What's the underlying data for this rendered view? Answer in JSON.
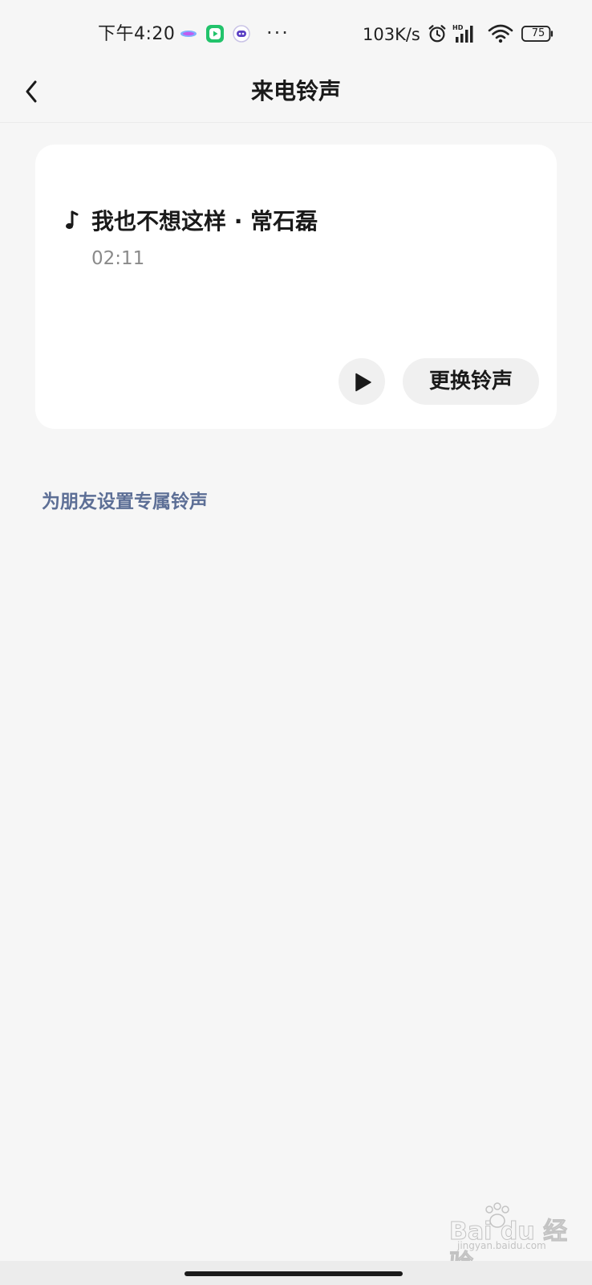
{
  "status_bar": {
    "time": "下午4:20",
    "more_indicator": "···",
    "network_speed": "103K/s",
    "battery_level": "75",
    "icons": [
      "bubble-app-icon",
      "green-play-app-icon",
      "astronaut-app-icon",
      "alarm-icon",
      "hd-signal-icon",
      "wifi-icon",
      "battery-icon"
    ]
  },
  "header": {
    "title": "来电铃声",
    "back_icon": "chevron-left-icon"
  },
  "ringtone_card": {
    "note_icon": "music-note-icon",
    "song_title": "我也不想这样 · 常石磊",
    "duration": "02:11",
    "play_icon": "play-icon",
    "change_button_label": "更换铃声"
  },
  "friend_ringtone": {
    "link_label": "为朋友设置专属铃声"
  },
  "watermark": {
    "logo_text": "Bai du 经验",
    "subtext": "jingyan.baidu.com"
  },
  "colors": {
    "background": "#f6f6f6",
    "card": "#ffffff",
    "accent_link": "#5d6f96",
    "secondary_text": "#8a8a8a",
    "button_bg": "#f0f0f0"
  }
}
